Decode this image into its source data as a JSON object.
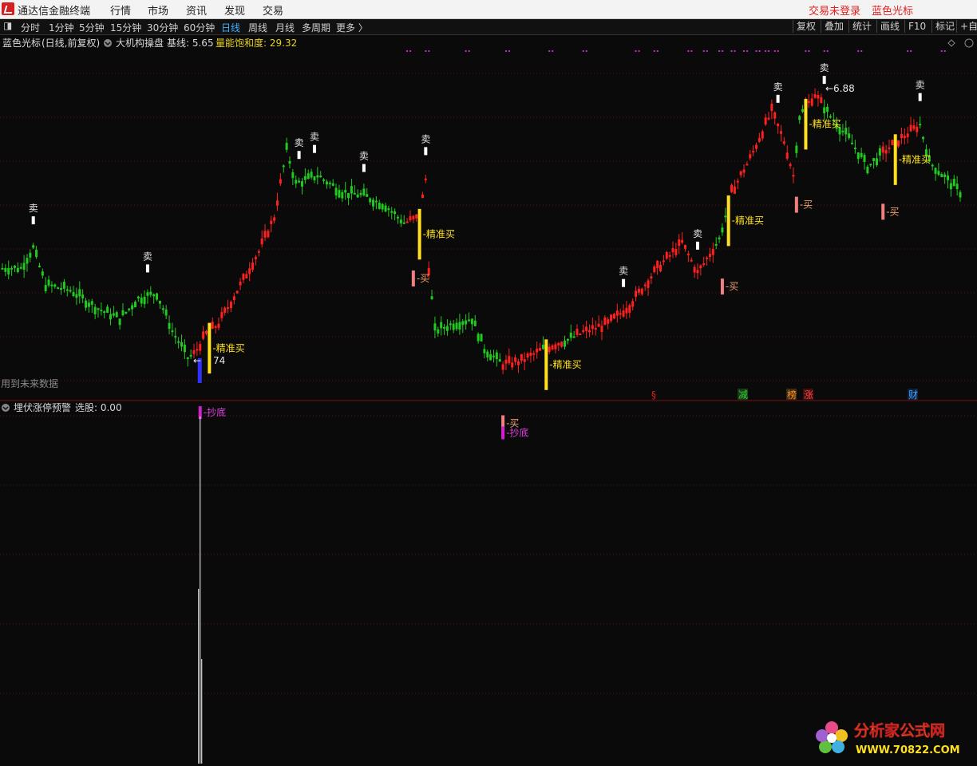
{
  "menubar": {
    "app_title": "通达信金融终端",
    "items": [
      "行情",
      "市场",
      "资讯",
      "发现",
      "交易"
    ],
    "login_status": "交易未登录",
    "indicator_name": "蓝色光标"
  },
  "toolbar": {
    "periods": [
      "分时",
      "1分钟",
      "5分钟",
      "15分钟",
      "30分钟",
      "60分钟",
      "日线",
      "周线",
      "月线",
      "多周期",
      "更多 〉"
    ],
    "active_period": "日线",
    "right_tools": [
      "复权",
      "叠加",
      "统计",
      "画线",
      "F10",
      "标记",
      "+自"
    ]
  },
  "main_panel": {
    "stock_name": "蓝色光标",
    "period_info": "(日线,前复权)",
    "indicator_title": "大机构操盘",
    "baseline_label": "基线: 5.65",
    "saturation_label": "量能饱和度: 29.32",
    "future_data_note": "用到未来数据",
    "high_price_label": "6.88",
    "low_price_label": "74",
    "sell_label": "卖",
    "buy_label": "买",
    "precise_buy_label": "精准买",
    "bottom_buy_label": "抄底",
    "event_markers": [
      "§",
      "减",
      "榜",
      "涨",
      "财"
    ]
  },
  "sub_panel": {
    "indicator_title": "埋伏涨停预警",
    "selection_label": "选股: 0.00"
  },
  "watermark": {
    "site_name": "分析家公式网",
    "url": "WWW.70822.COM"
  },
  "chart_data": {
    "type": "candlestick",
    "title": "大机构操盘",
    "price_range": [
      4.6,
      7.05
    ],
    "price_knots": [
      [
        0,
        5.85
      ],
      [
        6,
        5.85
      ],
      [
        10,
        5.97
      ],
      [
        14,
        5.75
      ],
      [
        22,
        5.72
      ],
      [
        30,
        5.62
      ],
      [
        38,
        5.55
      ],
      [
        44,
        5.67
      ],
      [
        50,
        5.7
      ],
      [
        55,
        5.48
      ],
      [
        60,
        5.32
      ],
      [
        62,
        5.34
      ],
      [
        66,
        5.46
      ],
      [
        70,
        5.52
      ],
      [
        78,
        5.78
      ],
      [
        83,
        5.95
      ],
      [
        88,
        6.15
      ],
      [
        92,
        6.55
      ],
      [
        95,
        6.35
      ],
      [
        102,
        6.4
      ],
      [
        110,
        6.3
      ],
      [
        117,
        6.28
      ],
      [
        124,
        6.22
      ],
      [
        130,
        6.12
      ],
      [
        135,
        6.15
      ],
      [
        137,
        6.38
      ],
      [
        138,
        5.85
      ],
      [
        140,
        5.48
      ],
      [
        146,
        5.52
      ],
      [
        152,
        5.55
      ],
      [
        156,
        5.37
      ],
      [
        162,
        5.28
      ],
      [
        168,
        5.3
      ],
      [
        175,
        5.37
      ],
      [
        182,
        5.42
      ],
      [
        188,
        5.47
      ],
      [
        196,
        5.52
      ],
      [
        203,
        5.63
      ],
      [
        212,
        5.85
      ],
      [
        220,
        6.0
      ],
      [
        225,
        5.82
      ],
      [
        232,
        6.02
      ],
      [
        236,
        6.3
      ],
      [
        242,
        6.5
      ],
      [
        249,
        6.78
      ],
      [
        253,
        6.6
      ],
      [
        256,
        6.4
      ],
      [
        258,
        6.75
      ],
      [
        263,
        6.88
      ],
      [
        268,
        6.75
      ],
      [
        274,
        6.62
      ],
      [
        280,
        6.45
      ],
      [
        286,
        6.55
      ],
      [
        291,
        6.62
      ],
      [
        297,
        6.7
      ],
      [
        300,
        6.48
      ],
      [
        306,
        6.37
      ],
      [
        310,
        6.3
      ]
    ],
    "red_ranges": [
      [
        62,
        90
      ],
      [
        131,
        138
      ],
      [
        162,
        174
      ],
      [
        176,
        181
      ],
      [
        186,
        230
      ],
      [
        236,
        256
      ],
      [
        260,
        265
      ],
      [
        285,
        296
      ]
    ],
    "n_bars": 311,
    "sell_signal_bars": [
      10,
      47,
      96,
      101,
      117,
      137,
      201,
      225,
      251,
      266,
      297
    ],
    "precise_buy_bars": [
      67,
      135,
      176,
      235,
      260,
      289
    ],
    "buy_bars": [
      133,
      162,
      233,
      257,
      285
    ],
    "bottom_bars": [
      64,
      162
    ],
    "sub_series": {
      "name": "选股",
      "spike_bar": 64,
      "value": 0.0
    }
  },
  "colors": {
    "up": "#ff2020",
    "down": "#21c921",
    "precise_buy": "#ffe020",
    "buy": "#f08080",
    "bottom": "#d020d0",
    "grid": "#5a1010",
    "menu_accent": "#e02020"
  }
}
